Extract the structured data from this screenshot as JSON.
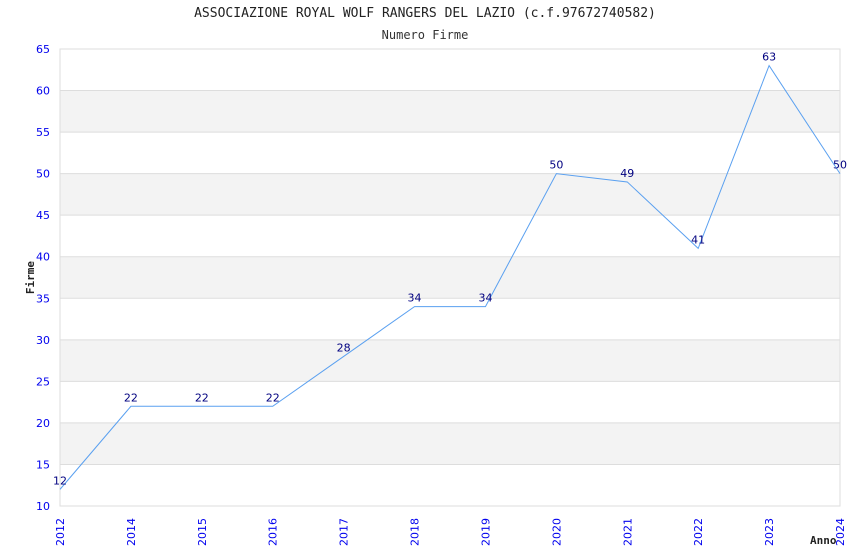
{
  "chart_data": {
    "type": "line",
    "title": "ASSOCIAZIONE ROYAL WOLF RANGERS DEL LAZIO (c.f.97672740582)",
    "subtitle": "Numero Firme",
    "xlabel": "Anno",
    "ylabel": "Firme",
    "categories": [
      "2012",
      "2014",
      "2015",
      "2016",
      "2017",
      "2018",
      "2019",
      "2020",
      "2021",
      "2022",
      "2023",
      "2024"
    ],
    "values": [
      12,
      22,
      22,
      22,
      28,
      34,
      34,
      50,
      49,
      41,
      63,
      50
    ],
    "ylim": [
      10,
      65
    ],
    "yticks": [
      10,
      15,
      20,
      25,
      30,
      35,
      40,
      45,
      50,
      55,
      60,
      65
    ],
    "grid": true,
    "colors": {
      "line": "#5aa0f0",
      "tick_labels": "#0000ee",
      "data_labels": "#000080",
      "band": "#f3f3f3"
    }
  }
}
